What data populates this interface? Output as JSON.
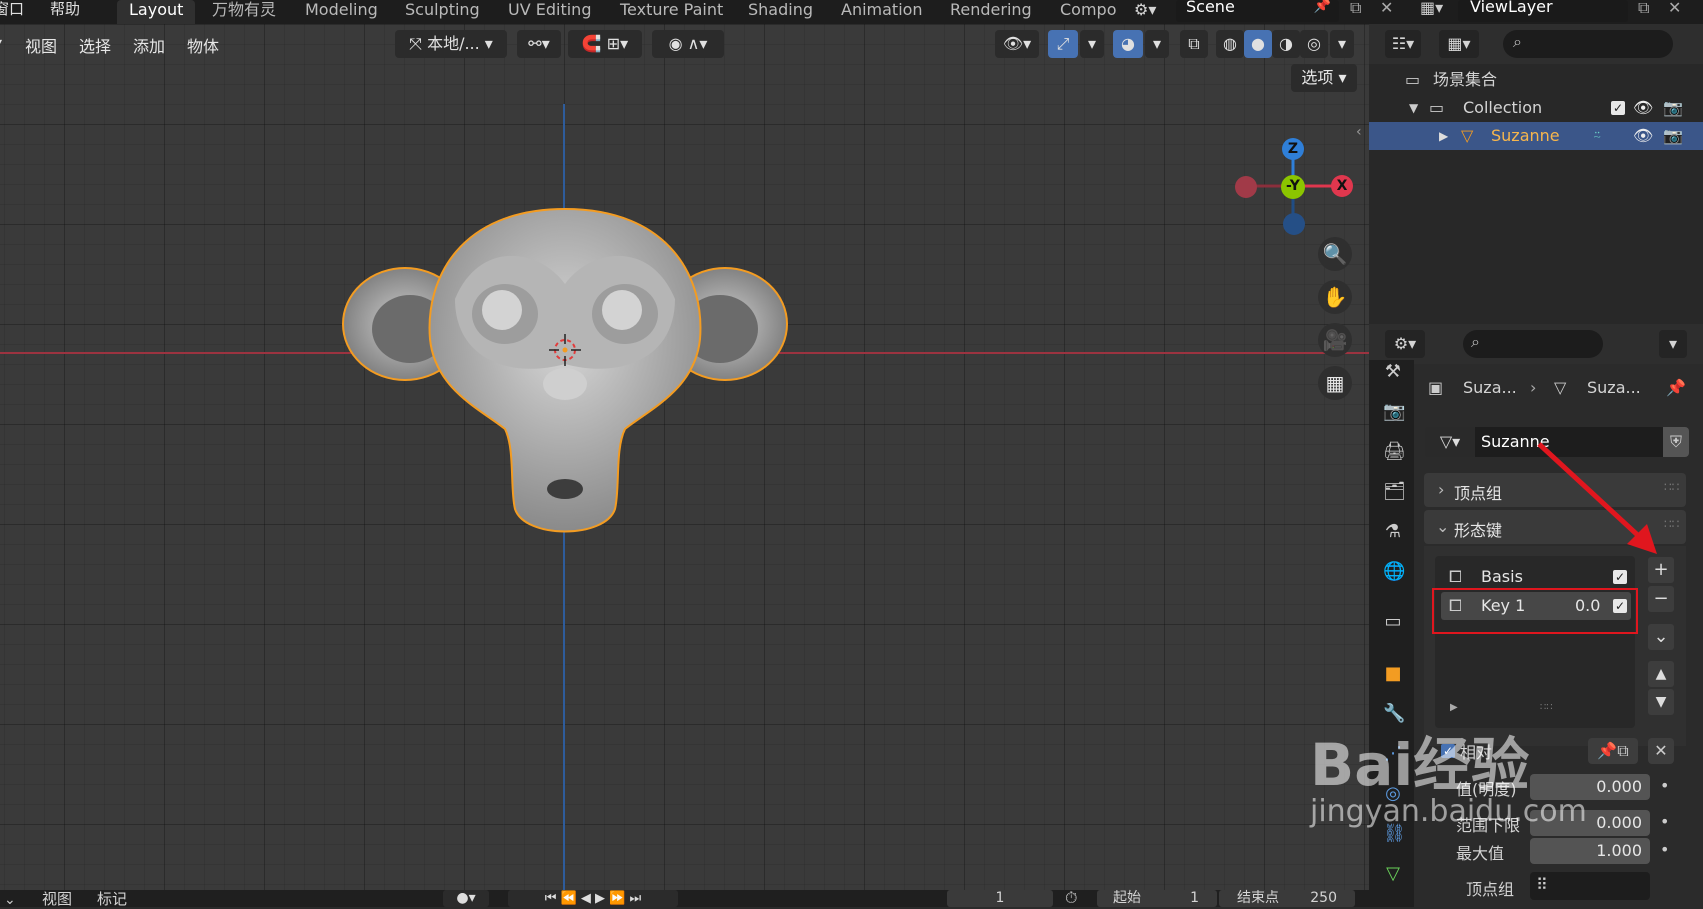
{
  "topbar": {
    "menu_window": "窗口",
    "menu_help": "帮助",
    "workspaces": [
      "Layout",
      "万物有灵",
      "Modeling",
      "Sculpting",
      "UV Editing",
      "Texture Paint",
      "Shading",
      "Animation",
      "Rendering",
      "Compo"
    ],
    "active_workspace": "Layout",
    "scene": "Scene",
    "view_layer": "ViewLayer"
  },
  "viewport_header": {
    "menus": [
      "视图",
      "选择",
      "添加",
      "物体"
    ],
    "transform_orientation": "本地/...",
    "options": "选项"
  },
  "gizmo": {
    "z": "Z",
    "y": "-Y",
    "x": "X"
  },
  "outliner": {
    "scene_collection": "场景集合",
    "collection": "Collection",
    "object": "Suzanne"
  },
  "properties": {
    "breadcrumb_object": "Suza...",
    "breadcrumb_mesh": "Suza...",
    "mesh_name": "Suzanne",
    "vertex_groups": "顶点组",
    "shape_keys": "形态键",
    "keys": [
      {
        "name": "Basis",
        "value": ""
      },
      {
        "name": "Key 1",
        "value": "0.0"
      }
    ],
    "relative": "相对",
    "value_label": "值(明度)",
    "value": "0.000",
    "range_min_label": "范围下限",
    "range_min": "0.000",
    "range_max_label": "最大值",
    "range_max": "1.000",
    "vertex_group_label": "顶点组"
  },
  "timeline": {
    "menus": [
      "视图",
      "标记"
    ],
    "current_frame": "1",
    "start_label": "起始",
    "start": "1",
    "end_label": "结束点",
    "end": "250"
  },
  "watermark": {
    "line1": "Bai经验",
    "line2": "jingyan.baidu.com"
  },
  "colors": {
    "selection": "#f39c22",
    "active_row": "#3b5689",
    "x_axis": "#e0374e",
    "y_axis": "#8bc500",
    "z_axis": "#2f7fd8",
    "annotation": "#e0161e"
  }
}
